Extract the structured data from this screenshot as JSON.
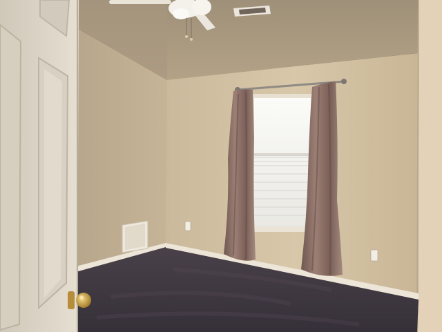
{
  "scene": {
    "subject": "empty bedroom",
    "palette": {
      "wall_left": "#bfae93",
      "wall_back": "#d2c0a2",
      "ceiling": "#a79880",
      "carpet": "#3f3841",
      "trim": "#e9e1d4",
      "curtain": "#8b6e64",
      "door": "#ddd6c8",
      "window_light": "#f2f1ed",
      "door_knob": "#c9a24a"
    }
  }
}
